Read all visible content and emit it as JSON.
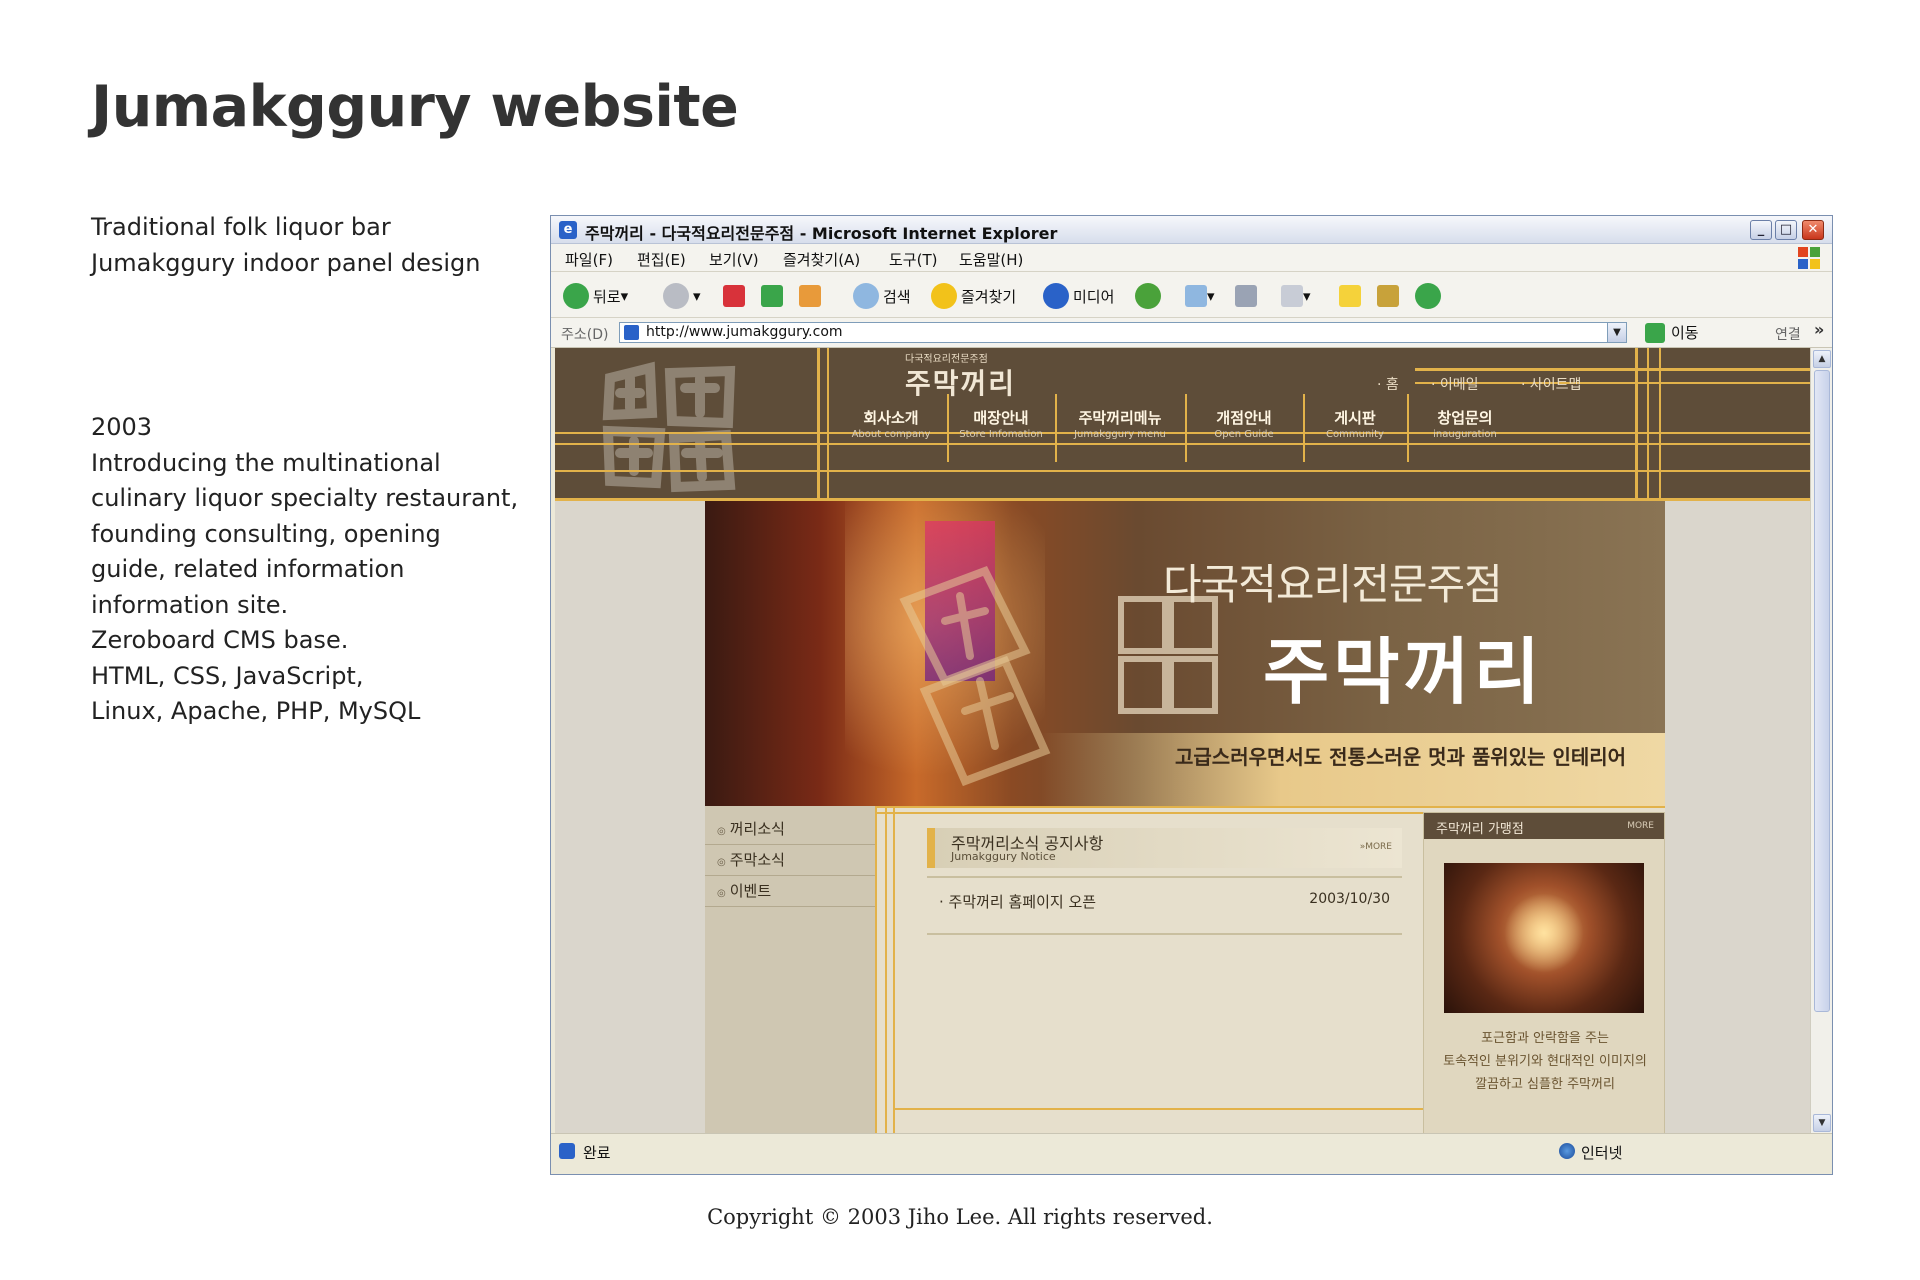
{
  "heading": "Jumakggury website",
  "description": {
    "summary_lines": [
      "Traditional folk liquor bar",
      "Jumakggury indoor panel design"
    ],
    "detail_lines": [
      "2003",
      "Introducing the multinational",
      "culinary liquor specialty restaurant,",
      "founding consulting, opening",
      "guide, related information",
      "information site.",
      "Zeroboard CMS base.",
      "HTML, CSS, JavaScript,",
      "Linux, Apache, PHP, MySQL"
    ]
  },
  "copyright": "Copyright © 2003 Jiho Lee. All rights reserved.",
  "browser": {
    "title": "주막꺼리 - 다국적요리전문주점 - Microsoft Internet Explorer",
    "menu": [
      "파일(F)",
      "편집(E)",
      "보기(V)",
      "즐겨찾기(A)",
      "도구(T)",
      "도움말(H)"
    ],
    "toolbar": {
      "back": "뒤로",
      "search": "검색",
      "favorites": "즐겨찾기",
      "media": "미디어"
    },
    "address_label": "주소(D)",
    "url": "http://www.jumakggury.com",
    "go_label": "이동",
    "links_label": "연결",
    "status_text": "완료",
    "status_zone": "인터넷"
  },
  "site": {
    "small_title": "다국적요리전문주점",
    "brand": "주막꺼리",
    "utility_links": [
      "· 홈",
      "· 이메일",
      "· 사이트맵"
    ],
    "nav": [
      {
        "ko": "회사소개",
        "en": "About company"
      },
      {
        "ko": "매장안내",
        "en": "Store Infomation"
      },
      {
        "ko": "주막꺼리메뉴",
        "en": "Jumakggury menu"
      },
      {
        "ko": "개점안내",
        "en": "Open Guide"
      },
      {
        "ko": "게시판",
        "en": "Community"
      },
      {
        "ko": "창업문의",
        "en": "inauguration"
      }
    ],
    "hero": {
      "title": "다국적요리전문주점",
      "brand": "주막꺼리",
      "tagline": "고급스러우면서도 전통스러운 멋과 품위있는 인테리어"
    },
    "left_nav": [
      "꺼리소식",
      "주막소식",
      "이벤트"
    ],
    "notice": {
      "title": "주막꺼리소식 공지사항",
      "subtitle": "Jumakggury Notice",
      "more": "»MORE",
      "items": [
        {
          "title": "· 주막꺼리 홈페이지 오픈",
          "date": "2003/10/30"
        }
      ]
    },
    "branch": {
      "title": "주막꺼리 가맹점",
      "more": "MORE",
      "caption_lines": [
        "포근함과 안락함을 주는",
        "토속적인 분위기와 현대적인 이미지의",
        "깔끔하고 심플한 주막꺼리"
      ]
    }
  },
  "colors": {
    "header_brown": "#5e4d39",
    "accent_gold": "#e2b24a",
    "content_beige": "#e6dfcc"
  }
}
